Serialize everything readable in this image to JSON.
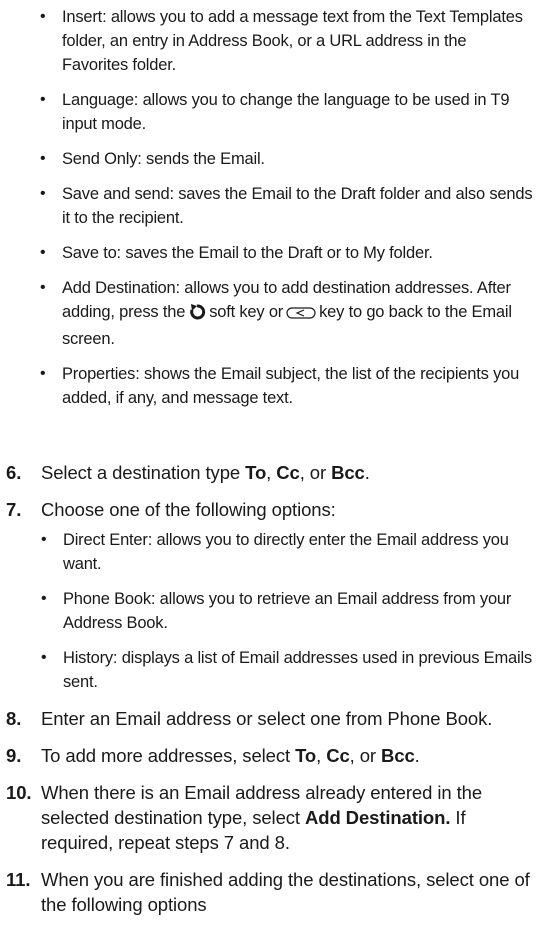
{
  "options_list": [
    "Insert: allows you to add a message text from the Text Templates folder, an entry in Address Book, or a URL address in the Favorites folder.",
    "Language: allows you to change the language to be used in T9 input mode.",
    "Send Only: sends the Email.",
    "Save and send: saves the Email to the Draft folder and also sends it to the recipient.",
    "Save to: saves the Email to the Draft or to My folder."
  ],
  "add_destination": {
    "before_back_icon": "Add Destination: allows you to add destination addresses. After adding, press the",
    "between_icons": "soft key or",
    "after_key_icon": "key to go back to the Email screen.",
    "icons": [
      "back-soft-key-icon",
      "c-key-icon"
    ]
  },
  "properties_item": "Properties: shows the Email subject, the list of the recipients you added, if any, and message text.",
  "steps": {
    "s6": {
      "num": "6.",
      "text_a": "Select a destination type ",
      "to": "To",
      "comma1": ", ",
      "cc": "Cc",
      "or": ", or ",
      "bcc": "Bcc",
      "end": "."
    },
    "s7": {
      "num": "7.",
      "text": "Choose one of the following options:",
      "options": [
        "Direct Enter: allows you to directly enter the Email address you want.",
        "Phone Book: allows you to retrieve an Email address from your Address Book.",
        "History: displays a list of Email addresses used in previous Emails sent."
      ]
    },
    "s8": {
      "num": "8.",
      "text": "Enter an Email address or select one from Phone Book."
    },
    "s9": {
      "num": "9.",
      "text_a": "To add more addresses, select ",
      "to": "To",
      "comma1": ", ",
      "cc": "Cc",
      "or": ", or ",
      "bcc": "Bcc",
      "end": "."
    },
    "s10": {
      "num": "10.",
      "text_a": "When there is an Email address already entered in the selected destination type, select ",
      "bold": "Add Destination.",
      "text_b": " If required, repeat steps 7 and 8."
    },
    "s11": {
      "num": "11.",
      "text": "When you are finished adding the destinations, select one of the following options"
    }
  }
}
